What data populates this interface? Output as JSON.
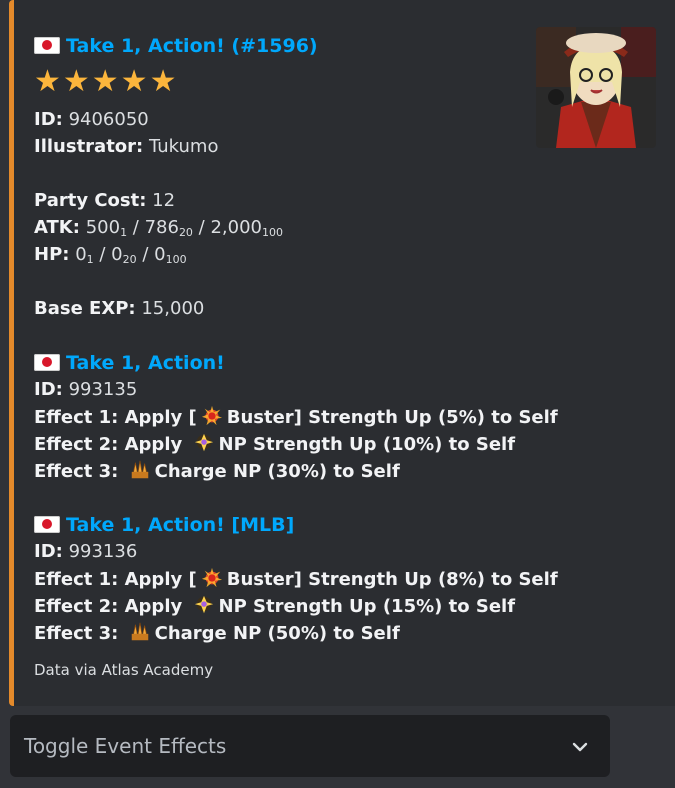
{
  "embed": {
    "accent_color": "#e48a2b",
    "title": "Take 1, Action! (#1596)",
    "flag": "japan-flag-icon",
    "rarity_stars": "★★★★★",
    "thumbnail": "character-portrait",
    "id": {
      "label": "ID:",
      "value": "9406050"
    },
    "illustrator": {
      "label": "Illustrator:",
      "value": "Tukumo"
    },
    "party_cost": {
      "label": "Party Cost:",
      "value": "12"
    },
    "atk": {
      "label": "ATK:",
      "v1": "500",
      "s1": "1",
      "sep1": " / ",
      "v2": "786",
      "s2": "20",
      "sep2": " / ",
      "v3": "2,000",
      "s3": "100"
    },
    "hp": {
      "label": "HP:",
      "v1": "0",
      "s1": "1",
      "sep1": " / ",
      "v2": "0",
      "s2": "20",
      "sep2": " / ",
      "v3": "0",
      "s3": "100"
    },
    "base_exp": {
      "label": "Base EXP:",
      "value": "15,000"
    },
    "skills": [
      {
        "name": "Take 1, Action!",
        "id_label": "ID:",
        "id": "993135",
        "effects": [
          {
            "pre": "Effect 1: Apply [",
            "icon": "buster-icon",
            "post": "Buster] Strength Up (5%) to Self"
          },
          {
            "pre": "Effect 2: Apply ",
            "icon": "np-strength-icon",
            "post": "NP Strength Up (10%) to Self"
          },
          {
            "pre": "Effect 3: ",
            "icon": "charge-np-icon",
            "post": "Charge NP (30%) to Self"
          }
        ]
      },
      {
        "name": "Take 1, Action! [MLB]",
        "id_label": "ID:",
        "id": "993136",
        "effects": [
          {
            "pre": "Effect 1: Apply [",
            "icon": "buster-icon",
            "post": "Buster] Strength Up (8%) to Self"
          },
          {
            "pre": "Effect 2: Apply ",
            "icon": "np-strength-icon",
            "post": "NP Strength Up (15%) to Self"
          },
          {
            "pre": "Effect 3: ",
            "icon": "charge-np-icon",
            "post": "Charge NP (50%) to Self"
          }
        ]
      }
    ],
    "footer": "Data via Atlas Academy"
  },
  "select_menu": {
    "label": "Toggle Event Effects",
    "icon": "chevron-down-icon"
  }
}
